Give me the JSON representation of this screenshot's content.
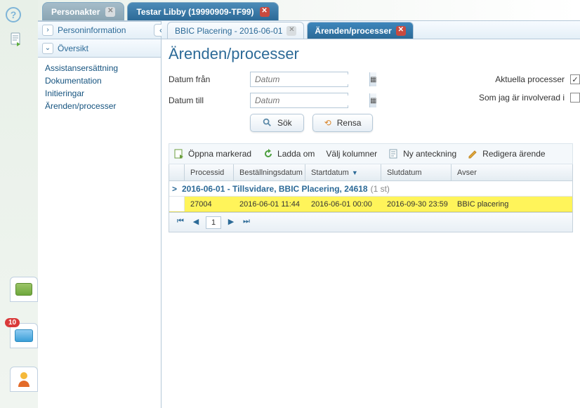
{
  "gutter": {
    "help_glyph": "?",
    "badge_count": "10"
  },
  "top_tabs": [
    {
      "label": "Personakter",
      "level": "inactive"
    },
    {
      "label": "Testar Libby (19990909-TF99)",
      "level": "active"
    }
  ],
  "sidebar": {
    "personinfo_label": "Personinformation",
    "oversikt_label": "Översikt",
    "items": [
      "Assistansersättning",
      "Dokumentation",
      "Initieringar",
      "Ärenden/processer"
    ]
  },
  "sub_tabs": [
    {
      "label": "BBIC Placering - 2016-06-01",
      "level": "inactive"
    },
    {
      "label": "Ärenden/processer",
      "level": "active"
    }
  ],
  "page": {
    "title": "Ärenden/processer",
    "datum_fran_label": "Datum från",
    "datum_till_label": "Datum till",
    "date_placeholder": "Datum",
    "aktuella_label": "Aktuella processer",
    "aktuella_checked": true,
    "involverad_label": "Som jag är involverad i",
    "involverad_checked": false,
    "sok_label": "Sök",
    "rensa_label": "Rensa"
  },
  "toolbar": {
    "oppna_label": "Öppna markerad",
    "ladda_label": "Ladda om",
    "kolumner_label": "Välj kolumner",
    "anteckning_label": "Ny anteckning",
    "redigera_label": "Redigera ärende"
  },
  "grid": {
    "headers": {
      "processid": "Processid",
      "bestallning": "Beställningsdatum",
      "startdatum": "Startdatum",
      "slutdatum": "Slutdatum",
      "avser": "Avser"
    },
    "group": {
      "chev": ">",
      "title": "2016-06-01 - Tillsvidare, BBIC Placering, 24618",
      "count": "(1 st)"
    },
    "rows": [
      {
        "processid": "27004",
        "bestallning": "2016-06-01 11:44",
        "startdatum": "2016-06-01 00:00",
        "slutdatum": "2016-09-30 23:59",
        "avser": "BBIC placering"
      }
    ],
    "pager": {
      "current": "1"
    }
  }
}
